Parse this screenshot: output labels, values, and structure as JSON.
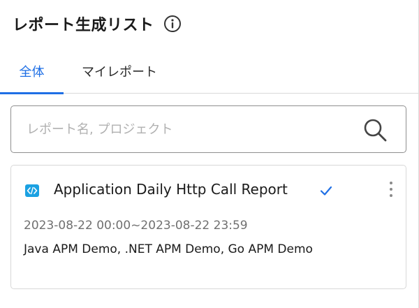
{
  "header": {
    "title": "レポート生成リスト",
    "info_icon": "info-circle-icon"
  },
  "tabs": [
    {
      "label": "全体",
      "active": true
    },
    {
      "label": "マイレポート",
      "active": false
    }
  ],
  "search": {
    "value": "",
    "placeholder": "レポート名, プロジェクト",
    "icon": "search-icon"
  },
  "reports": [
    {
      "title": "Application Daily Http Call Report",
      "type_icon": "code-icon",
      "status_icon": "checkmark-icon",
      "period": "2023-08-22 00:00~2023-08-22 23:59",
      "projects": "Java APM Demo, .NET APM Demo, Go APM Demo",
      "menu_icon": "more-vertical-icon"
    }
  ],
  "colors": {
    "accent": "#1f6fe5",
    "code_icon_bg": "#1ba1e2",
    "check": "#1f6fe5"
  }
}
